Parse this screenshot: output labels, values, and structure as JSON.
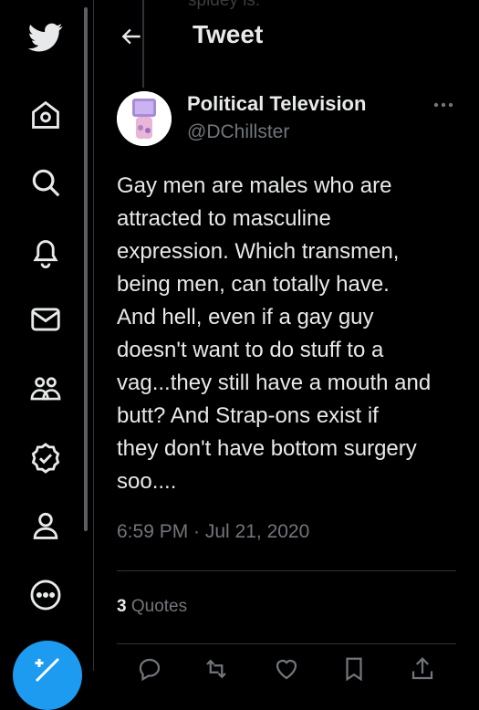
{
  "background_text": "spidey is.",
  "header": {
    "title": "Tweet"
  },
  "author": {
    "name": "Political Television",
    "handle": "@DChillster"
  },
  "tweet": {
    "lines": [
      "Gay men are males who are",
      "attracted to masculine",
      "expression. Which transmen,",
      "being men, can totally have.",
      "And hell, even if a gay guy",
      "doesn't want to do stuff to a",
      "vag...they still have a mouth and",
      "butt? And Strap-ons exist if",
      "they don't have bottom surgery",
      "soo...."
    ],
    "time": "6:59 PM · Jul 21, 2020"
  },
  "stats": {
    "quotes_count": "3",
    "quotes_label": "Quotes"
  },
  "sidebar": {
    "items": [
      {
        "icon": "twitter-logo-icon"
      },
      {
        "icon": "home-icon"
      },
      {
        "icon": "search-icon"
      },
      {
        "icon": "notifications-bell-icon"
      },
      {
        "icon": "messages-envelope-icon"
      },
      {
        "icon": "communities-icon"
      },
      {
        "icon": "verified-icon"
      },
      {
        "icon": "profile-icon"
      },
      {
        "icon": "more-circle-icon"
      },
      {
        "icon": "compose-tweet-icon"
      }
    ]
  },
  "colors": {
    "background": "#000000",
    "text": "#e7e9ea",
    "muted": "#71767b",
    "accent": "#1d9bf0",
    "border": "#2f3336"
  }
}
